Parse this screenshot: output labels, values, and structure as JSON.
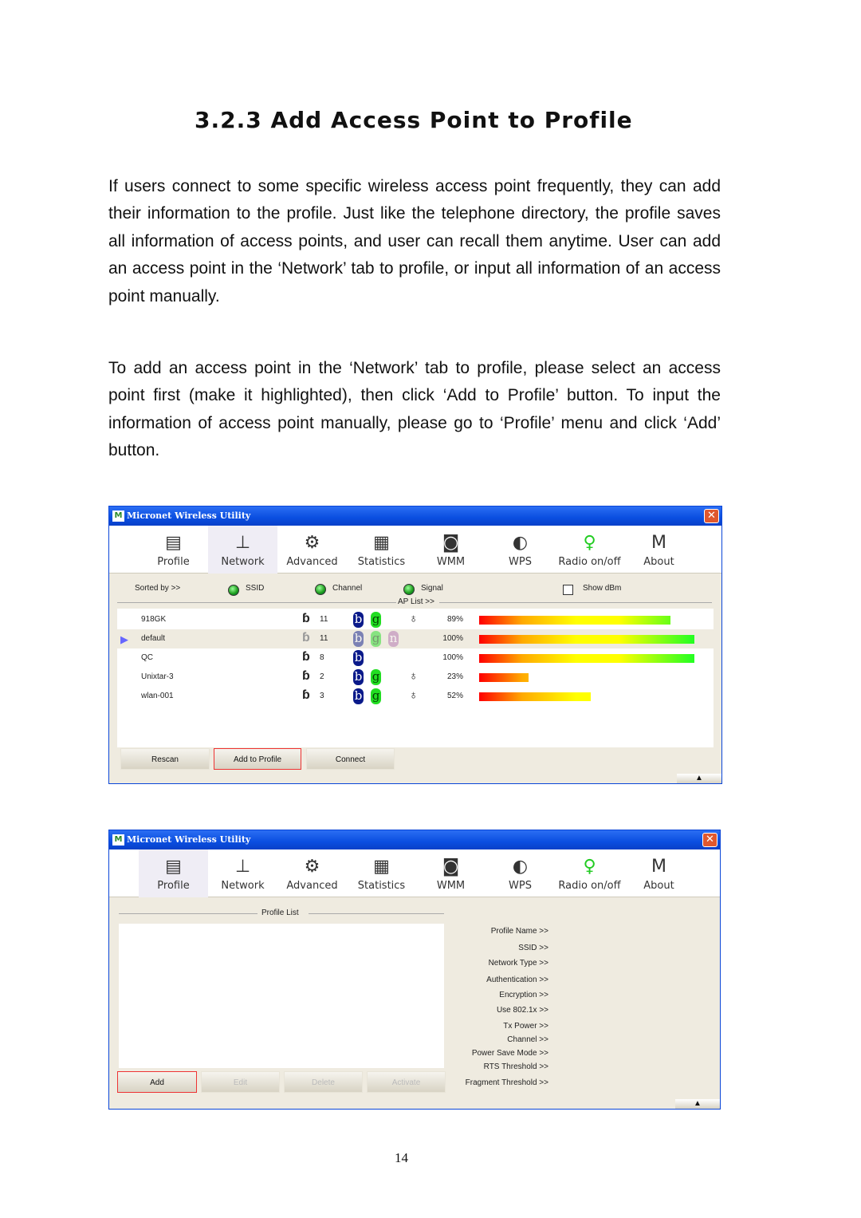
{
  "heading": "3.2.3  Add Access Point to Profile",
  "paragraphs": [
    "If users connect to some specific wireless access point frequently, they can add their information to the profile. Just like the telephone directory, the profile saves all information of access points, and user can recall them anytime. User can add an access point in the ‘Network’ tab to profile, or input all information of an access point manually.",
    "To add an access point in the ‘Network’ tab to profile, please select an access point first (make it highlighted), then click ‘Add to Profile’ button. To input the information of access point manually, please go to ‘Profile’ menu and click ‘Add’ button."
  ],
  "window_title": "Micronet Wireless Utility",
  "logo_text": "M4",
  "tabs": [
    {
      "label": "Profile",
      "icon": "profile-icon"
    },
    {
      "label": "Network",
      "icon": "router-icon"
    },
    {
      "label": "Advanced",
      "icon": "gears-icon"
    },
    {
      "label": "Statistics",
      "icon": "calculator-icon"
    },
    {
      "label": "WMM",
      "icon": "qos-icon"
    },
    {
      "label": "WPS",
      "icon": "wps-icon"
    },
    {
      "label": "Radio on/off",
      "icon": "antenna-icon"
    },
    {
      "label": "About",
      "icon": "about-icon"
    }
  ],
  "network": {
    "selected_tab": "Network",
    "sorted_by": "Sorted by >>",
    "sort_ssid": "SSID",
    "sort_channel": "Channel",
    "sort_signal": "Signal",
    "show_dbm": "Show dBm",
    "show_dbm_checked": false,
    "ap_list_label": "AP List >>",
    "aps": [
      {
        "ssid": "918GK",
        "channel": "11",
        "modes": [
          "b",
          "g"
        ],
        "secured": true,
        "signal": "89%",
        "signal_value": 89,
        "selected": false
      },
      {
        "ssid": "default",
        "channel": "11",
        "modes": [
          "b",
          "g",
          "n"
        ],
        "secured": false,
        "signal": "100%",
        "signal_value": 100,
        "selected": true
      },
      {
        "ssid": "QC",
        "channel": "8",
        "modes": [
          "b"
        ],
        "secured": false,
        "signal": "100%",
        "signal_value": 100,
        "selected": false
      },
      {
        "ssid": "Unixtar-3",
        "channel": "2",
        "modes": [
          "b",
          "g"
        ],
        "secured": true,
        "signal": "23%",
        "signal_value": 23,
        "selected": false
      },
      {
        "ssid": "wlan-001",
        "channel": "3",
        "modes": [
          "b",
          "g"
        ],
        "secured": true,
        "signal": "52%",
        "signal_value": 52,
        "selected": false
      }
    ],
    "buttons": {
      "rescan": "Rescan",
      "add_to_profile": "Add to Profile",
      "connect": "Connect"
    }
  },
  "profile": {
    "selected_tab": "Profile",
    "list_label": "Profile List",
    "fields": [
      "Profile Name >>",
      "SSID >>",
      "Network Type >>",
      "Authentication >>",
      "Encryption >>",
      "Use 802.1x >>",
      "Tx Power >>",
      "Channel >>",
      "Power Save Mode >>",
      "RTS Threshold >>",
      "Fragment Threshold >>"
    ],
    "buttons": {
      "add": "Add",
      "edit": "Edit",
      "delete": "Delete",
      "activate": "Activate"
    }
  },
  "colors": {
    "mode_b": "#0a1a8a",
    "mode_g": "#22dd22",
    "mode_n": "#b070b0",
    "title_bar": "#0a4ee0"
  },
  "page_number": "14"
}
